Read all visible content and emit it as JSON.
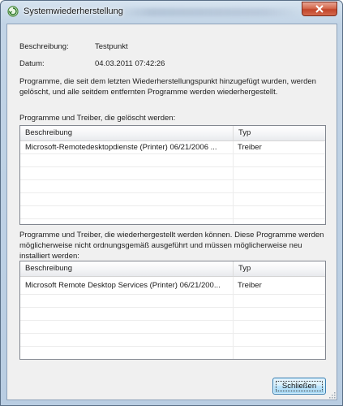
{
  "window": {
    "title": "Systemwiederherstellung"
  },
  "info": {
    "description_label": "Beschreibung:",
    "description_value": "Testpunkt",
    "date_label": "Datum:",
    "date_value": "04.03.2011 07:42:26",
    "paragraph": "Programme, die seit dem letzten Wiederherstellungspunkt hinzugefügt wurden, werden gelöscht, und alle seitdem entfernten Programme werden wiederhergestellt."
  },
  "deleted_section": {
    "label": "Programme und Treiber, die gelöscht werden:",
    "columns": [
      "Beschreibung",
      "Typ"
    ],
    "rows": [
      {
        "description": "Microsoft-Remotedesktopdienste (Printer) 06/21/2006 ...",
        "type": "Treiber"
      }
    ]
  },
  "restored_section": {
    "label": "Programme und Treiber, die wiederhergestellt werden können. Diese Programme werden möglicherweise nicht ordnungsgemäß ausgeführt und müssen möglicherweise neu installiert werden:",
    "columns": [
      "Beschreibung",
      "Typ"
    ],
    "rows": [
      {
        "description": "Microsoft Remote Desktop Services (Printer) 06/21/200...",
        "type": "Treiber"
      }
    ]
  },
  "buttons": {
    "close_label": "Schließen"
  },
  "icons": {
    "app": "system-restore-icon",
    "close": "close-icon",
    "grip": "resize-grip-icon"
  }
}
